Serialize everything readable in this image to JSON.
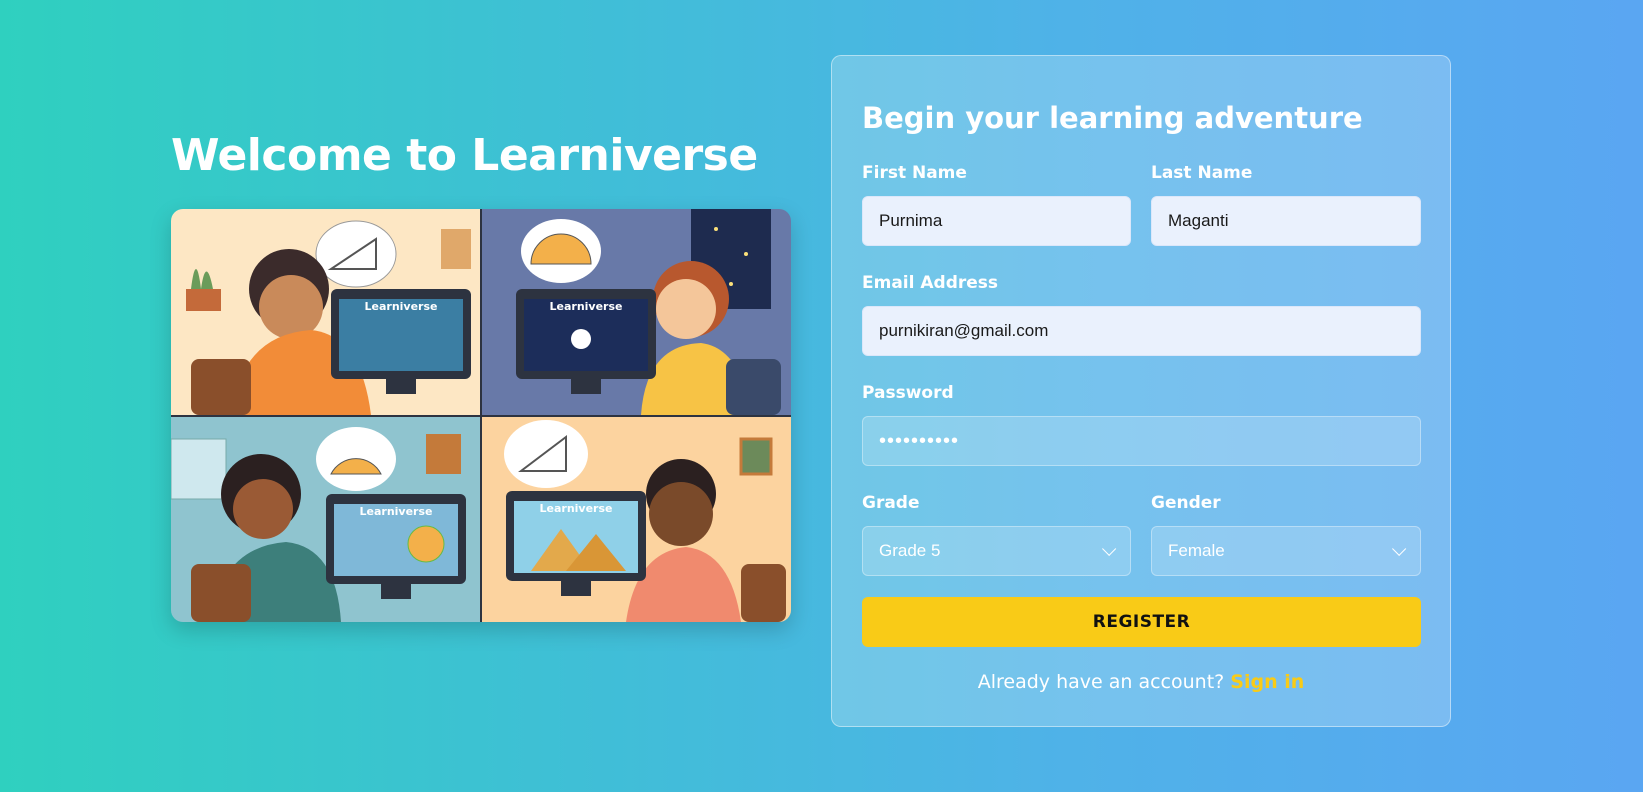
{
  "hero": {
    "title": "Welcome to Learniverse",
    "screen_label": "Learniverse"
  },
  "form": {
    "heading": "Begin your learning adventure",
    "first_name": {
      "label": "First Name",
      "value": "Purnima"
    },
    "last_name": {
      "label": "Last Name",
      "value": "Maganti"
    },
    "email": {
      "label": "Email Address",
      "value": "purnikiran@gmail.com"
    },
    "password": {
      "label": "Password",
      "value": "••••••••••"
    },
    "grade": {
      "label": "Grade",
      "value": "Grade 5"
    },
    "gender": {
      "label": "Gender",
      "value": "Female"
    },
    "register_label": "REGISTER",
    "signin_prompt": "Already have an account?",
    "signin_link": "Sign in"
  },
  "colors": {
    "accent": "#f9cb17",
    "input_bg": "#eaf1fd"
  }
}
